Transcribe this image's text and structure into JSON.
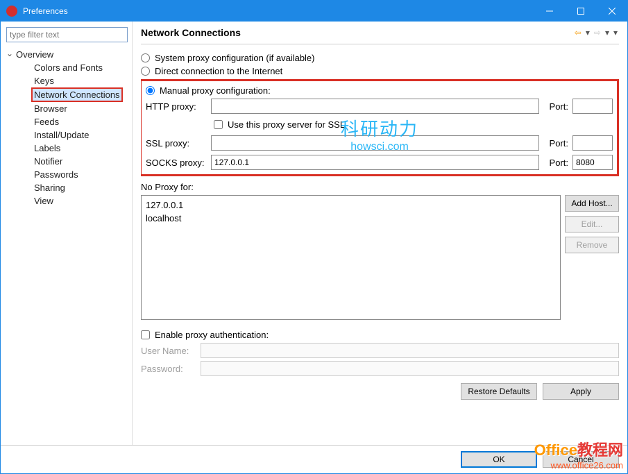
{
  "window": {
    "title": "Preferences"
  },
  "filter": {
    "placeholder": "type filter text"
  },
  "tree": {
    "root": "Overview",
    "items": [
      "Colors and Fonts",
      "Keys",
      "Network Connections",
      "Browser",
      "Feeds",
      "Install/Update",
      "Labels",
      "Notifier",
      "Passwords",
      "Sharing",
      "View"
    ],
    "selectedIndex": 2
  },
  "page": {
    "title": "Network Connections",
    "radios": {
      "system": "System proxy configuration (if available)",
      "direct": "Direct connection to the Internet",
      "manual": "Manual proxy configuration:",
      "selected": "manual"
    },
    "proxy": {
      "http_label": "HTTP proxy:",
      "ssl_label": "SSL proxy:",
      "socks_label": "SOCKS proxy:",
      "port_label": "Port:",
      "use_for_ssl_label": "Use this proxy server for SSL",
      "http_host": "",
      "http_port": "",
      "ssl_host": "",
      "ssl_port": "",
      "socks_host": "127.0.0.1",
      "socks_port": "8080",
      "use_for_ssl": false
    },
    "noproxy": {
      "label": "No Proxy for:",
      "items": [
        "127.0.0.1",
        "localhost"
      ],
      "buttons": {
        "add": "Add Host...",
        "edit": "Edit...",
        "remove": "Remove"
      }
    },
    "auth": {
      "enable_label": "Enable proxy authentication:",
      "enabled": false,
      "user_label": "User Name:",
      "pass_label": "Password:",
      "user": "",
      "pass": ""
    },
    "footer": {
      "restore": "Restore Defaults",
      "apply": "Apply"
    }
  },
  "dialog_footer": {
    "ok": "OK",
    "cancel": "Cancel"
  },
  "watermark": {
    "cn": "科研动力",
    "en": "howsci.com"
  },
  "corner": {
    "line1a": "Office",
    "line1b": "教程网",
    "line2": "www.office26.com"
  }
}
